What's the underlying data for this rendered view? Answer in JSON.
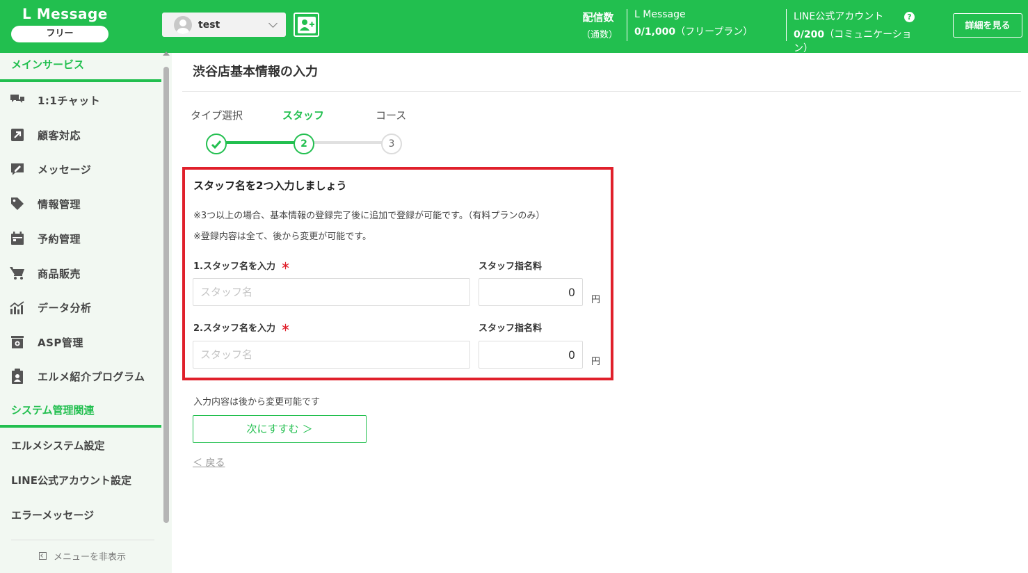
{
  "header": {
    "brand": "L Message",
    "plan": "フリー",
    "account": "test",
    "stats_label_line1": "配信数",
    "stats_label_line2": "（通数）",
    "stat1_title": "L Message",
    "stat1_value": "0/1,000",
    "stat1_suffix": "（フリープラン）",
    "stat2_title": "LINE公式アカウント",
    "stat2_value": "0/200",
    "stat2_suffix": "（コミュニケーション）",
    "help": "?",
    "detail_button": "詳細を見る"
  },
  "sidebar": {
    "main_section": "メインサービス",
    "items": [
      {
        "label": "1:1チャット",
        "icon": "chat-icon"
      },
      {
        "label": "顧客対応",
        "icon": "arrow-up-right-icon"
      },
      {
        "label": "メッセージ",
        "icon": "message-edit-icon"
      },
      {
        "label": "情報管理",
        "icon": "tag-icon"
      },
      {
        "label": "予約管理",
        "icon": "calendar-icon"
      },
      {
        "label": "商品販売",
        "icon": "cart-icon"
      },
      {
        "label": "データ分析",
        "icon": "chart-icon"
      },
      {
        "label": "ASP管理",
        "icon": "asp-box-icon"
      },
      {
        "label": "エルメ紹介プログラム",
        "icon": "clipboard-user-icon"
      }
    ],
    "system_section": "システム管理関連",
    "system_items": [
      "エルメシステム設定",
      "LINE公式アカウント設定",
      "エラーメッセージ"
    ],
    "hide_menu": "メニューを非表示"
  },
  "main": {
    "title": "渋谷店基本情報の入力",
    "steps": [
      {
        "label": "タイプ選択",
        "mark": "✓"
      },
      {
        "label": "スタッフ",
        "mark": "2"
      },
      {
        "label": "コース",
        "mark": "3"
      }
    ],
    "form": {
      "heading": "スタッフ名を2つ入力しましょう",
      "note1": "※3つ以上の場合、基本情報の登録完了後に追加で登録が可能です。（有料プランのみ）",
      "note2": "※登録内容は全て、後から変更が可能です。",
      "staff1_label": "1.スタッフ名を入力",
      "staff2_label": "2.スタッフ名を入力",
      "required": "＊",
      "fee_label": "スタッフ指名料",
      "name_placeholder": "スタッフ名",
      "fee1_value": "0",
      "fee2_value": "0",
      "yen": "円"
    },
    "bottom_note": "入力内容は後から変更可能です",
    "next_button": "次にすすむ ＞",
    "back_link": "＜ 戻る"
  },
  "colors": {
    "brand_green": "#22bf4f",
    "highlight_red": "#e0202b"
  }
}
